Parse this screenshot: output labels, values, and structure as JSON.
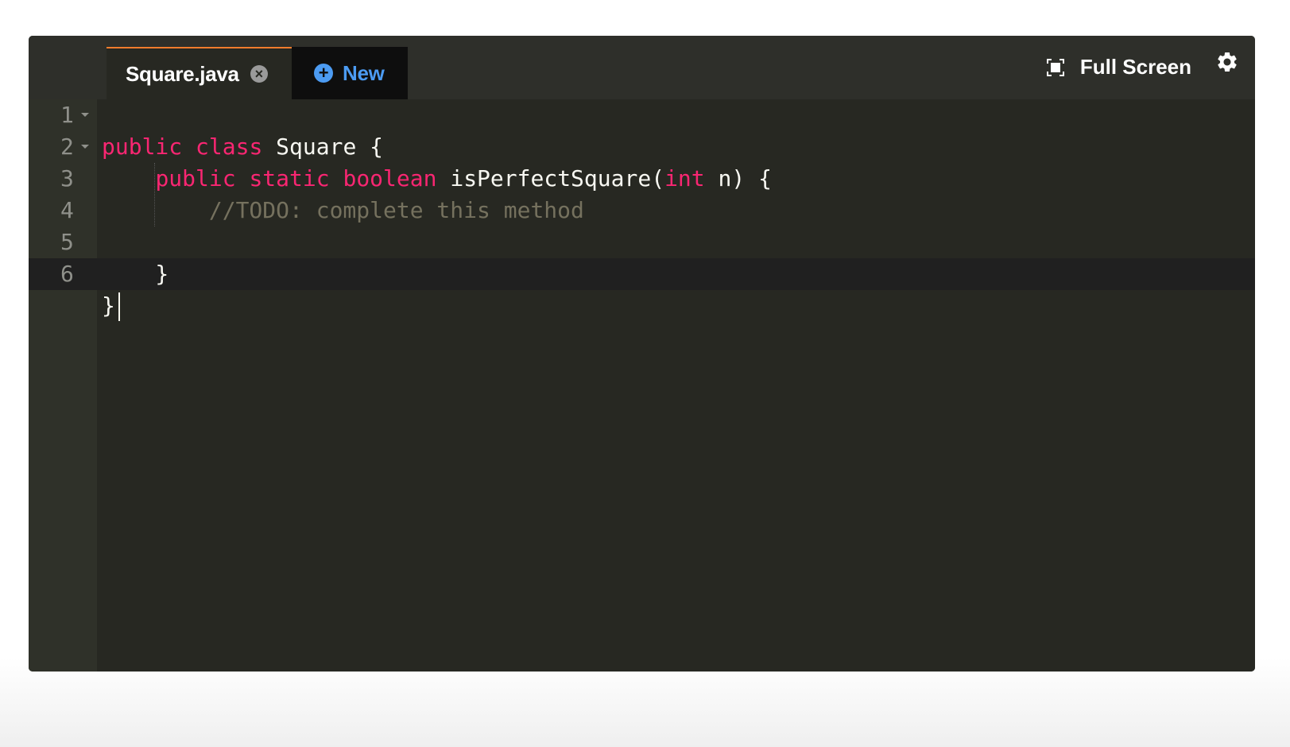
{
  "tabs": {
    "file_label": "Square.java",
    "new_label": "New"
  },
  "toolbar": {
    "fullscreen_label": "Full Screen"
  },
  "gutter": {
    "line_numbers": [
      "1",
      "2",
      "3",
      "4",
      "5",
      "6"
    ]
  },
  "code": {
    "line1": {
      "kw1": "public",
      "kw2": "class",
      "rest": " Square {"
    },
    "line2": {
      "indent": "    ",
      "kw1": "public",
      "kw2": "static",
      "kw3": "boolean",
      "mid": " isPerfectSquare(",
      "kw4": "int",
      "rest": " n) {"
    },
    "line3": {
      "indent": "        ",
      "comment": "//TODO: complete this method"
    },
    "line4": {
      "text": ""
    },
    "line5": {
      "text": "    }"
    },
    "line6": {
      "text": "}"
    }
  },
  "colors": {
    "editor_bg": "#272822",
    "keyword": "#f92672",
    "comment": "#75715e",
    "active_tab_accent": "#f47c2c",
    "new_tab_text": "#4c9bf2"
  },
  "icons": {
    "close": "close-circle-icon",
    "add": "plus-circle-icon",
    "fullscreen": "fullscreen-icon",
    "settings": "gear-icon",
    "fold": "fold-arrow-icon"
  }
}
